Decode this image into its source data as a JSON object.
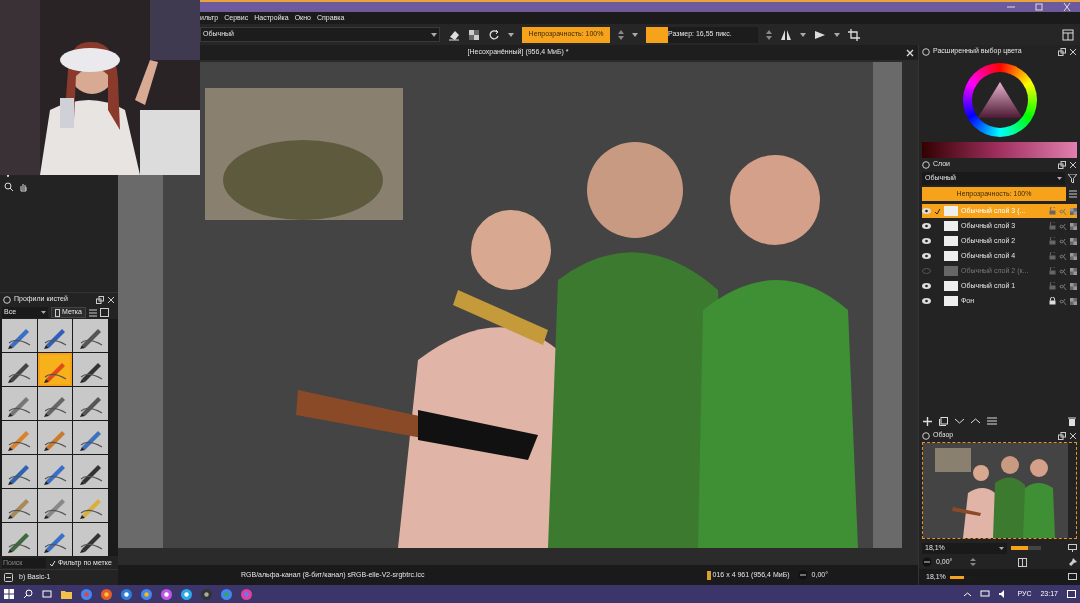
{
  "menu": [
    "ильтр",
    "Сервис",
    "Настройка",
    "Окно",
    "Справка"
  ],
  "toolbar": {
    "blend_mode": "Обычный",
    "opacity": "Непрозрачность: 100%",
    "opacity_slider": {
      "level": 1
    },
    "size": "Размер: 16,55 пикс.",
    "size_slider": {
      "level": 0.2
    }
  },
  "document_tab": {
    "title": "[Несохранённый]  (956,4 МиБ) *"
  },
  "color_docker": {
    "title": "Расширенный выбор цвета"
  },
  "layers_docker": {
    "title": "Слои",
    "blend_mode": "Обычный",
    "opacity": "Непрозрачность: 100%",
    "opacity_slider": {
      "level": 1
    },
    "layers": [
      {
        "name": "Обычный слой 3 (...",
        "visible": true,
        "selected": true,
        "locked": false
      },
      {
        "name": "Обычный слой 3",
        "visible": true,
        "selected": false,
        "locked": false
      },
      {
        "name": "Обычный слой 2",
        "visible": true,
        "selected": false,
        "locked": false
      },
      {
        "name": "Обычный слой 4",
        "visible": true,
        "selected": false,
        "locked": false
      },
      {
        "name": "Обычный слой 2 (к...",
        "visible": false,
        "selected": false,
        "locked": false
      },
      {
        "name": "Обычный слой 1",
        "visible": true,
        "selected": false,
        "locked": false
      },
      {
        "name": "Фон",
        "visible": true,
        "selected": false,
        "locked": true
      }
    ]
  },
  "overview_docker": {
    "title": "Обзор",
    "zoom": "18,1%",
    "rotation": "0,00°",
    "level": 0.55
  },
  "brush_docker": {
    "title": "Профили кистей",
    "tag_filter": "Все",
    "tag_button": "Метка",
    "search_placeholder": "Поиск",
    "filter_label": "Фильтр по метке",
    "filter_checked": true,
    "current_preset": "b) Basic-1",
    "presets": [
      {
        "selected": false
      },
      {
        "selected": false
      },
      {
        "selected": false
      },
      {
        "selected": false
      },
      {
        "selected": true
      },
      {
        "selected": false
      },
      {
        "selected": false
      },
      {
        "selected": false
      },
      {
        "selected": false
      },
      {
        "selected": false
      },
      {
        "selected": false
      },
      {
        "selected": false
      },
      {
        "selected": false
      },
      {
        "selected": false
      },
      {
        "selected": false
      },
      {
        "selected": false
      },
      {
        "selected": false
      },
      {
        "selected": false
      },
      {
        "selected": false
      },
      {
        "selected": false
      },
      {
        "selected": false
      }
    ]
  },
  "status_bar": {
    "color_space": "RGB/альфа-канал (8-бит/канал)  sRGB-elle-V2-srgbtrc.icc",
    "image_size": "016 x 4 961 (956,4 МиБ)",
    "rotation": "0,00°",
    "zoom": "18,1%",
    "zoom_slider": {
      "level": 0.6
    }
  },
  "taskbar": {
    "language": "РУС",
    "time": "23:17"
  }
}
